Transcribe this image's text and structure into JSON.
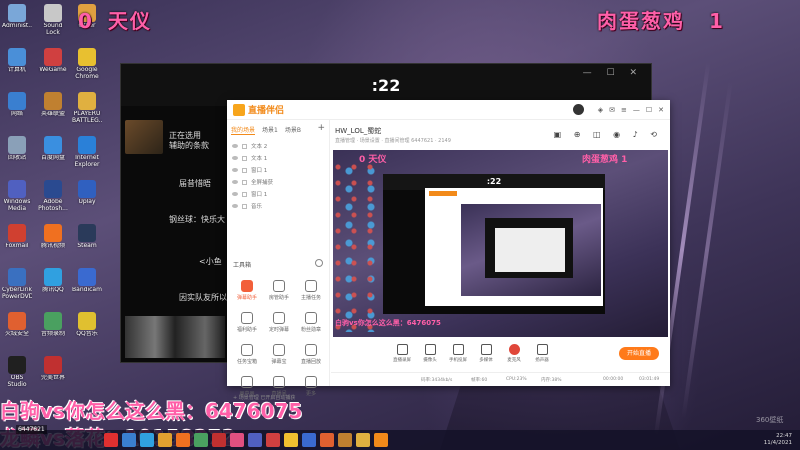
{
  "overlay": {
    "left_score": "0",
    "left_name": "天仪",
    "right_name": "肉蛋葱鸡",
    "right_score": "1",
    "danmu_top": "白驹vs你怎么这么黑：6476075",
    "danmu_bottom": "龙鳞vs落花：10158272"
  },
  "desktop_icons": [
    {
      "label": "Administ...",
      "color": "#7aa7d8"
    },
    {
      "label": "Sound Lock",
      "color": "#c8c8c8"
    },
    {
      "label": "Other",
      "color": "#e0a040"
    },
    {
      "label": "计算机",
      "color": "#4a8fd8"
    },
    {
      "label": "WeGame",
      "color": "#d04040"
    },
    {
      "label": "Google Chrome",
      "color": "#e8c030"
    },
    {
      "label": "网络",
      "color": "#3a7fd0"
    },
    {
      "label": "英雄联盟",
      "color": "#c08030"
    },
    {
      "label": "PLAYERU BATTLEG...",
      "color": "#e0b040"
    },
    {
      "label": "回收站",
      "color": "#8aa0b8"
    },
    {
      "label": "百度网盘",
      "color": "#3a8fe0"
    },
    {
      "label": "Internet Explorer",
      "color": "#2a80d8"
    },
    {
      "label": "Windows Media",
      "color": "#5060c0"
    },
    {
      "label": "Adobe Photosh...",
      "color": "#2a4a90"
    },
    {
      "label": "Uplay",
      "color": "#3060c0"
    },
    {
      "label": "Foxmail",
      "color": "#d04030"
    },
    {
      "label": "腾讯视频",
      "color": "#f07020"
    },
    {
      "label": "Steam",
      "color": "#2a3a5a"
    },
    {
      "label": "CyberLink PowerDVD",
      "color": "#3a70c0"
    },
    {
      "label": "腾讯QQ",
      "color": "#30a0e0"
    },
    {
      "label": "Bandicam",
      "color": "#3a6ad0"
    },
    {
      "label": "火绒安全",
      "color": "#e06030"
    },
    {
      "label": "音频录制",
      "color": "#4aa060"
    },
    {
      "label": "QQ音乐",
      "color": "#e0c030"
    },
    {
      "label": "OBS Studio",
      "color": "#202020"
    },
    {
      "label": "完美世界",
      "color": "#c03030"
    }
  ],
  "stream_window": {
    "timer": ":22",
    "chat": [
      "正在选用",
      "辅助的条款",
      "届昔惜晤",
      "钢丝球：快乐大",
      "<小鱼",
      "因实队友所以"
    ]
  },
  "app": {
    "logo": "直播伴侣",
    "tabs": [
      "我的场景",
      "场景1",
      "场景B"
    ],
    "sources": [
      "文本 2",
      "文本 1",
      "窗口 1",
      "全屏捕获",
      "窗口 1",
      "音乐"
    ],
    "tools_title": "工具箱",
    "tools": [
      {
        "label": "弹幕助手",
        "hot": true
      },
      {
        "label": "房管助手",
        "hot": false
      },
      {
        "label": "主播任务",
        "hot": false
      },
      {
        "label": "福利助手",
        "hot": false
      },
      {
        "label": "定时弹幕",
        "hot": false
      },
      {
        "label": "粉丝勋章",
        "hot": false
      },
      {
        "label": "任务宝箱",
        "hot": false
      },
      {
        "label": "弹幕宝",
        "hot": false
      },
      {
        "label": "直播回放",
        "hot": false
      },
      {
        "label": "画中画",
        "hot": false
      },
      {
        "label": "直播间",
        "hot": false
      },
      {
        "label": "更多",
        "hot": false
      }
    ],
    "sidebar_footer": "+ 场景管理 已开启自动捕获",
    "room_title": "HW_LOL_蜀蛇",
    "room_sub": "直播管理 · 场景设置 · 直播间管理 6447621 · 2149",
    "preview": {
      "left_score_text": "0 天仪",
      "right_score_text": "肉蛋葱鸡 1",
      "timer": ":22",
      "danmu": "白驹vs你怎么这么黑：6476075"
    },
    "toolbar": [
      {
        "label": "直播录屏",
        "hot": false
      },
      {
        "label": "摄像头",
        "hot": false
      },
      {
        "label": "手机投屏",
        "hot": false
      },
      {
        "label": "多媒体",
        "hot": false
      },
      {
        "label": "麦克风",
        "hot": true
      },
      {
        "label": "扬声器",
        "hot": false
      }
    ],
    "go_live": "开始直播",
    "status": {
      "bitrate": "码率:3434kb/s",
      "fps": "帧率:60",
      "cpu": "CPU:23%",
      "mem": "内存:38%",
      "left_time": "00:00:00",
      "right_time": "03:01:49"
    }
  },
  "taskbar": {
    "viewers": "6447621",
    "clock_time": "22:47",
    "clock_date": "11/4/2021",
    "watermark": "360壁纸",
    "apps": [
      "#e03030",
      "#3a7fd0",
      "#30a0e0",
      "#e0a030",
      "#f07020",
      "#4aa060",
      "#c03030",
      "#e05080",
      "#5060c0",
      "#d04040",
      "#f0c030",
      "#3a6ad0",
      "#e06030",
      "#c08030",
      "#e0b040",
      "#f28a1a"
    ]
  }
}
